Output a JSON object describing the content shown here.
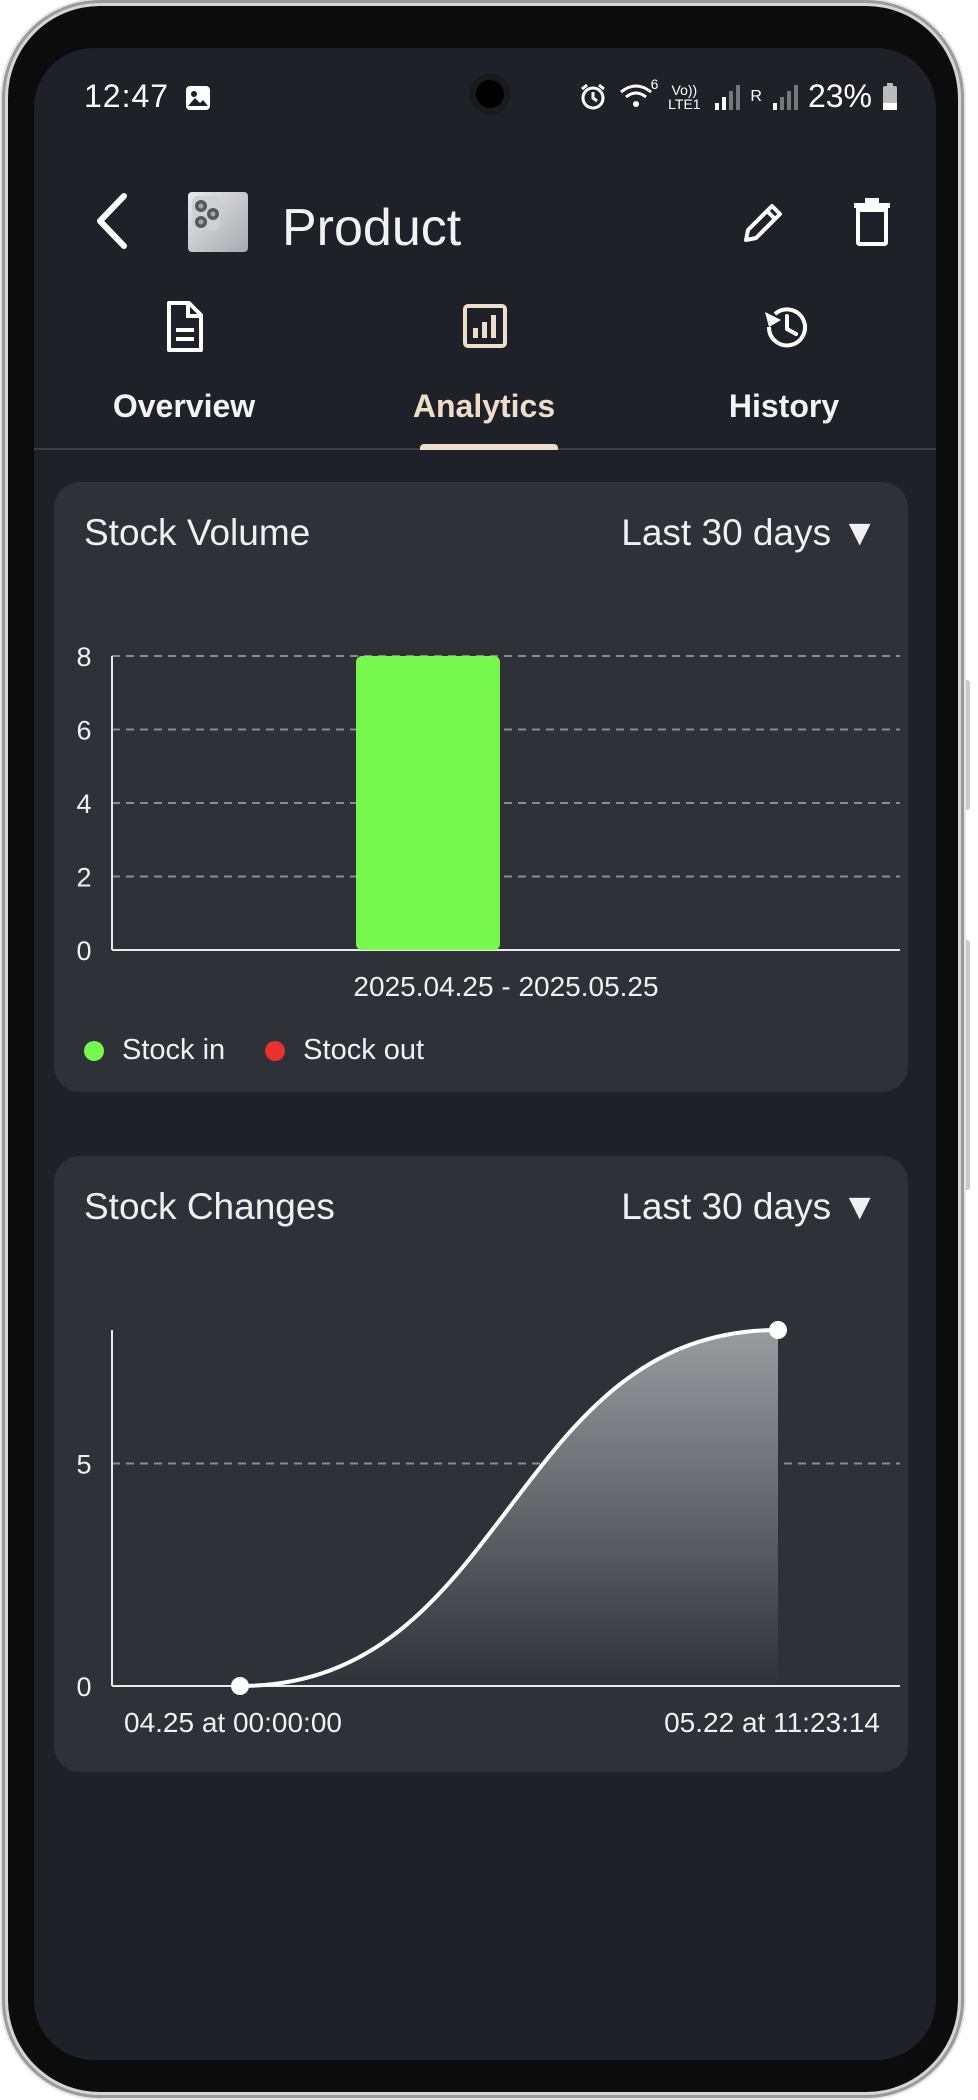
{
  "status_bar": {
    "time": "12:47",
    "battery": "23%",
    "network_badge_1": "6",
    "network_badge_2": "Vo)) LTE1",
    "network_badge_3": "R"
  },
  "app_bar": {
    "title": "Product",
    "back_icon": "arrow-back",
    "edit_icon": "pencil",
    "delete_icon": "trash"
  },
  "tabs": [
    {
      "label": "Overview",
      "icon": "document",
      "active": false
    },
    {
      "label": "Analytics",
      "icon": "bar-chart",
      "active": true
    },
    {
      "label": "History",
      "icon": "history-clock",
      "active": false
    }
  ],
  "colors": {
    "background": "#1f2128",
    "card": "#2f3139",
    "accent": "#eeddca",
    "stock_in": "#76f94c",
    "stock_out": "#e8322b"
  },
  "stock_volume": {
    "title": "Stock Volume",
    "range_label": "Last 30 days ▼",
    "legend": [
      {
        "label": "Stock in",
        "color": "#76f94c"
      },
      {
        "label": "Stock out",
        "color": "#e8322b"
      }
    ],
    "chart_data": {
      "type": "bar",
      "categories": [
        "2025.04.25 - 2025.05.25"
      ],
      "series": [
        {
          "name": "Stock in",
          "values": [
            8
          ]
        },
        {
          "name": "Stock out",
          "values": [
            0
          ]
        }
      ],
      "yticks": [
        "0",
        "2",
        "4",
        "6",
        "8"
      ],
      "ylim": [
        0,
        8
      ],
      "grid": true
    }
  },
  "stock_changes": {
    "title": "Stock Changes",
    "range_label": "Last 30 days ▼",
    "chart_data": {
      "type": "area",
      "x_labels": [
        "04.25 at 00:00:00",
        "05.22 at 11:23:14"
      ],
      "values": [
        0,
        8
      ],
      "yticks": [
        "0",
        "5"
      ],
      "ylim": [
        0,
        8
      ],
      "grid": true
    }
  }
}
